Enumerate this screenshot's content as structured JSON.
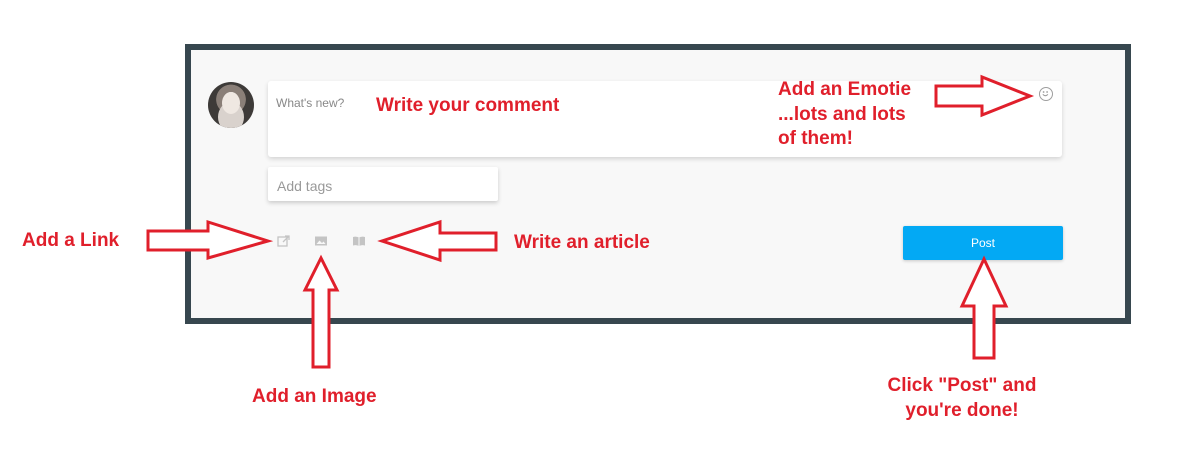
{
  "composer": {
    "comment_placeholder": "What's new?",
    "tags_placeholder": "Add tags",
    "post_label": "Post",
    "accent_color": "#03a9f4",
    "frame_color": "#37474f",
    "tools": [
      {
        "name": "link",
        "icon": "external-link-icon"
      },
      {
        "name": "image",
        "icon": "image-icon"
      },
      {
        "name": "article",
        "icon": "book-icon"
      }
    ],
    "emoji_icon": "smiley-icon"
  },
  "annotations": {
    "write_comment": "Write your comment",
    "emotie_line1": "Add an Emotie",
    "emotie_line2": "...lots and lots",
    "emotie_line3": "of them!",
    "add_link": "Add a Link",
    "write_article": "Write an article",
    "add_image": "Add an Image",
    "post_line1": "Click \"Post\" and",
    "post_line2": "you're done!",
    "color": "#e01f2b"
  }
}
